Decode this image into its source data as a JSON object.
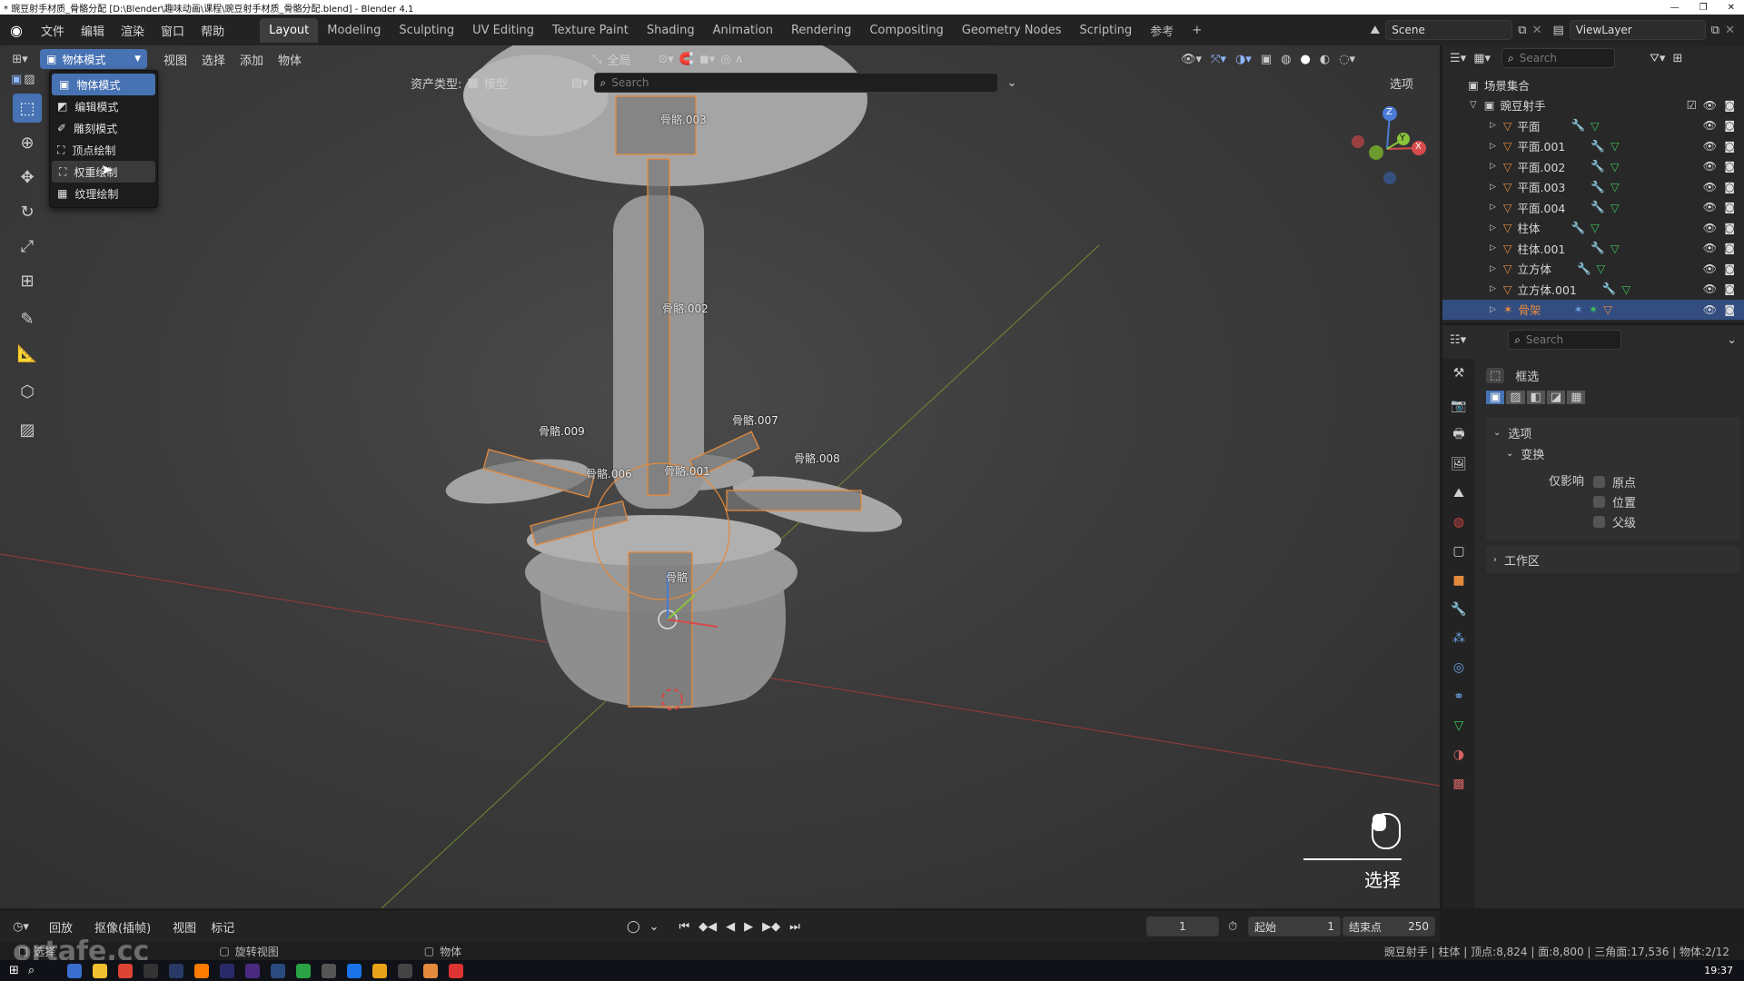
{
  "window": {
    "title": "* 豌豆射手材质_骨骼分配 [D:\\Blender\\趣味动画\\课程\\豌豆射手材质_骨骼分配.blend] - Blender 4.1"
  },
  "menubar": {
    "items": [
      "文件",
      "编辑",
      "渲染",
      "窗口",
      "帮助"
    ]
  },
  "workspaces": [
    "Layout",
    "Modeling",
    "Sculpting",
    "UV Editing",
    "Texture Paint",
    "Shading",
    "Animation",
    "Rendering",
    "Compositing",
    "Geometry Nodes",
    "Scripting",
    "参考"
  ],
  "workspace_add": "+",
  "scene": {
    "name": "Scene",
    "view_layer": "ViewLayer"
  },
  "viewport_header": {
    "mode": "物体模式",
    "menus": [
      "视图",
      "选择",
      "添加",
      "物体"
    ],
    "transform_orientation": "全局",
    "options_label": "选项"
  },
  "asset_bar": {
    "label": "资产类型:",
    "type": "模型",
    "search_placeholder": "Search"
  },
  "mode_menu": {
    "items": [
      "物体模式",
      "编辑模式",
      "雕刻模式",
      "顶点绘制",
      "权重绘制",
      "纹理绘制"
    ],
    "selected_index": 0,
    "hovered_index": 4
  },
  "bones": {
    "b003": "骨骼.003",
    "b002": "骨骼.002",
    "b009": "骨骼.009",
    "b007": "骨骼.007",
    "b008": "骨骼.008",
    "b006": "骨骼.006",
    "b001": "骨骼.001",
    "root": "骨骼"
  },
  "gizmo": {
    "x": "X",
    "y": "Y",
    "z": "Z"
  },
  "overlay_hint": {
    "label": "选择"
  },
  "outliner": {
    "search_placeholder": "Search",
    "collection": "场景集合",
    "root": "豌豆射手",
    "items": [
      "平面",
      "平面.001",
      "平面.002",
      "平面.003",
      "平面.004",
      "柱体",
      "柱体.001",
      "立方体",
      "立方体.001",
      "骨架"
    ],
    "active_item": "骨架"
  },
  "properties": {
    "search_placeholder": "Search",
    "tool_name": "框选",
    "section_options": "选项",
    "section_transform": "变换",
    "affect_only_label": "仅影响",
    "checkboxes": [
      "原点",
      "位置",
      "父级"
    ],
    "section_workspace": "工作区"
  },
  "timeline": {
    "playback": "回放",
    "keying": "抠像(插帧)",
    "view": "视图",
    "marker": "标记",
    "current_frame": "1",
    "start_label": "起始",
    "start": "1",
    "end_label": "结束点",
    "end": "250"
  },
  "statusbar": {
    "left1": "选择",
    "left2": "旋转视图",
    "left3": "物体",
    "stats": "豌豆射手 | 柱体 | 顶点:8,824 | 面:8,800 | 三角面:17,536 | 物体:2/12",
    "clock": "19:37",
    "watermark": "ortafe.cc"
  },
  "colors": {
    "accent": "#4772b3",
    "orange": "#e38a3d",
    "bg": "#303030"
  }
}
